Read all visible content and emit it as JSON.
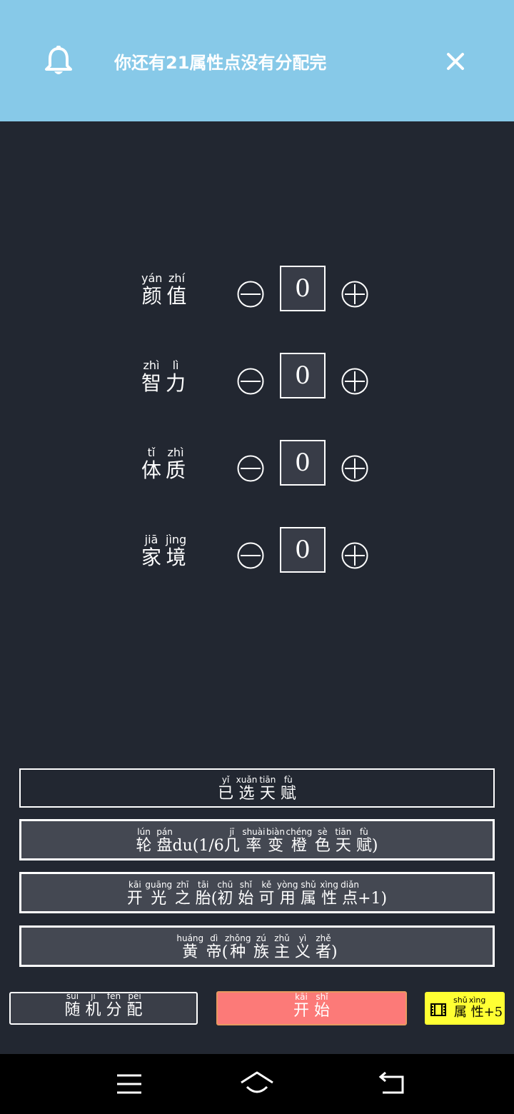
{
  "notification": {
    "message": "你还有21属性点没有分配完",
    "icon": "bell-icon",
    "close_icon": "close-icon"
  },
  "stats": [
    {
      "chars": [
        "颜",
        "值"
      ],
      "pinyin": [
        "yán",
        "zhí"
      ],
      "value": "0"
    },
    {
      "chars": [
        "智",
        "力"
      ],
      "pinyin": [
        "zhì",
        "lì"
      ],
      "value": "0"
    },
    {
      "chars": [
        "体",
        "质"
      ],
      "pinyin": [
        "tǐ",
        "zhì"
      ],
      "value": "0"
    },
    {
      "chars": [
        "家",
        "境"
      ],
      "pinyin": [
        "jiā",
        "jìng"
      ],
      "value": "0"
    }
  ],
  "talents": {
    "selected": {
      "chars": [
        "已",
        "选",
        "天",
        "赋"
      ],
      "pinyin": [
        "yǐ",
        "xuǎn",
        "tiān",
        "fù"
      ]
    },
    "t1": {
      "c": [
        "轮",
        "盘",
        "du(1/6",
        "几",
        "率",
        "变",
        "橙",
        "色",
        "天",
        "赋",
        ")"
      ],
      "p": [
        "lún",
        "pán",
        "",
        "jī",
        "shuài",
        "biàn",
        "chéng",
        "sè",
        "tiān",
        "fù",
        ""
      ]
    },
    "t2": {
      "c": [
        "开",
        "光",
        "之",
        "胎",
        "(",
        "初",
        "始",
        "可",
        "用",
        "属",
        "性",
        "点",
        "+1)"
      ],
      "p": [
        "kāi",
        "guāng",
        "zhī",
        "tāi",
        "",
        "chū",
        "shǐ",
        "kě",
        "yòng",
        "shǔ",
        "xìng",
        "diǎn",
        ""
      ]
    },
    "t3": {
      "c": [
        "黄",
        "帝",
        "(",
        "种",
        "族",
        "主",
        "义",
        "者",
        ")"
      ],
      "p": [
        "huáng",
        "dì",
        "",
        "zhǒng",
        "zú",
        "zhǔ",
        "yì",
        "zhě",
        ""
      ]
    }
  },
  "actions": {
    "random": {
      "c": [
        "随",
        "机",
        "分",
        "配"
      ],
      "p": [
        "suí",
        "jī",
        "fēn",
        "pèi"
      ]
    },
    "start": {
      "c": [
        "开",
        "始"
      ],
      "p": [
        "kāi",
        "shǐ"
      ]
    },
    "attr": {
      "c": [
        "属",
        "性"
      ],
      "p": [
        "shǔ",
        "xìng"
      ],
      "suffix": "+5",
      "icon": "film-icon"
    }
  },
  "colors": {
    "background": "#222731",
    "notification": "#87c9e8",
    "start_button": "#fc7a78",
    "attr_button": "#ffff33"
  },
  "navbar": {
    "icons": [
      "menu-icon",
      "home-icon",
      "back-icon"
    ]
  }
}
